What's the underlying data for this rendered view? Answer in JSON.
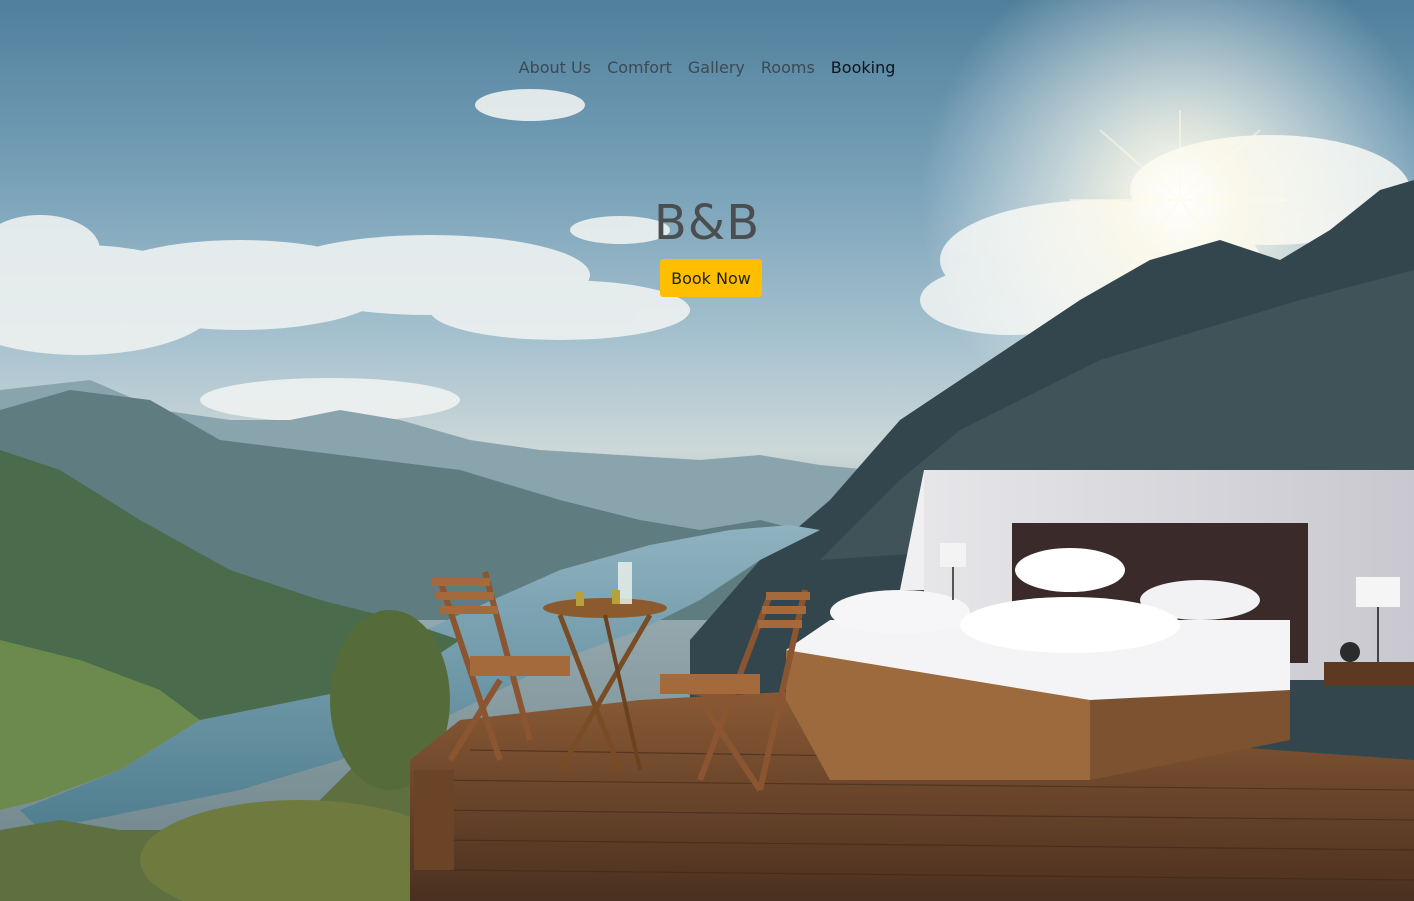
{
  "nav": {
    "items": [
      {
        "label": "About Us"
      },
      {
        "label": "Comfort"
      },
      {
        "label": "Gallery"
      },
      {
        "label": "Rooms"
      },
      {
        "label": "Booking"
      }
    ],
    "active_index": 4
  },
  "hero": {
    "title": "B&B",
    "cta_label": "Book Now"
  },
  "colors": {
    "accent": "#ffbf00",
    "nav_text": "#3c4a52",
    "nav_active": "#101418",
    "title_text": "#4b4e50"
  },
  "icons": {
    "scene": "mountain-lake-deck-bed-photo"
  }
}
